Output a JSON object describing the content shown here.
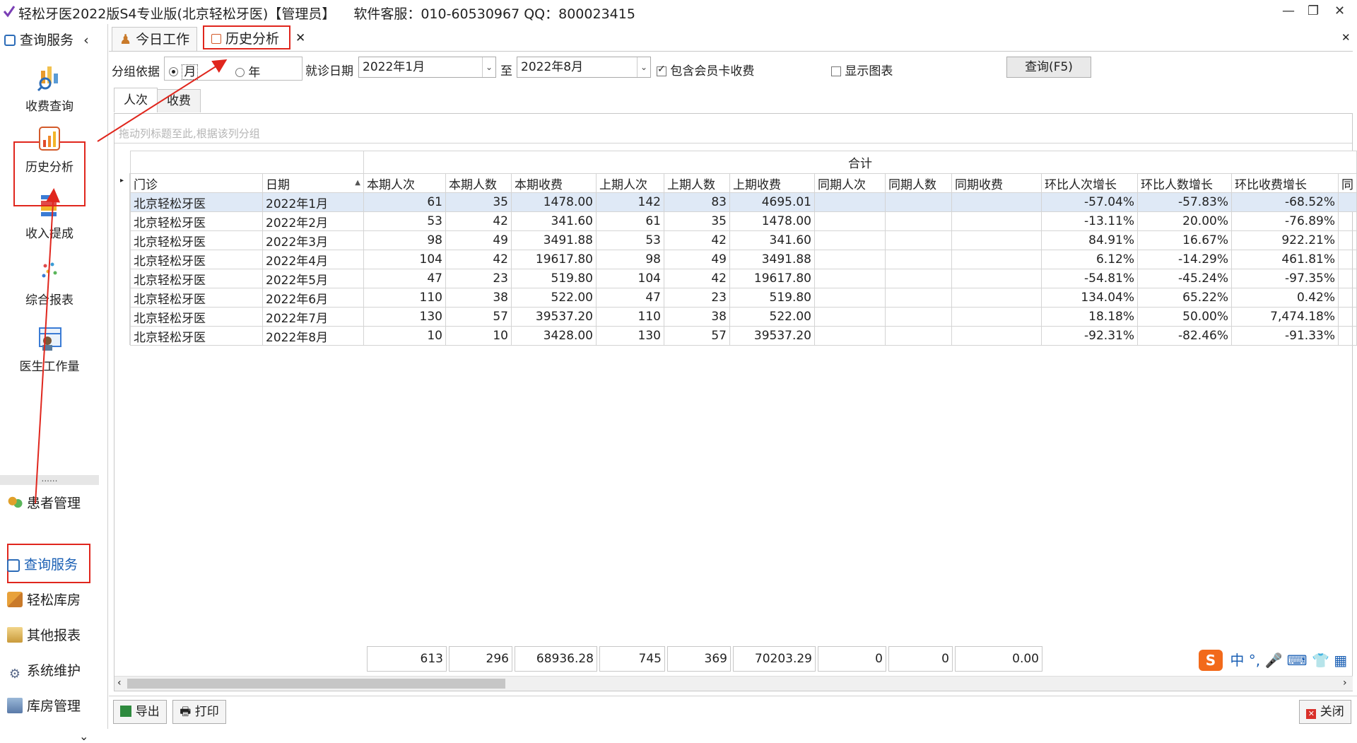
{
  "window": {
    "title": "轻松牙医2022版S4专业版(北京轻松牙医)【管理员】",
    "support": "软件客服：010-60530967 QQ：800023415"
  },
  "sidebar": {
    "header": "查询服务",
    "items": [
      {
        "label": "收费查询",
        "icon": "chart-search-icon"
      },
      {
        "label": "历史分析",
        "icon": "bar-chart-icon"
      },
      {
        "label": "收入提成",
        "icon": "stack-bars-icon"
      },
      {
        "label": "综合报表",
        "icon": "dots-icon"
      },
      {
        "label": "医生工作量",
        "icon": "doctor-calendar-icon"
      }
    ],
    "separator": "......",
    "nav": [
      {
        "label": "患者管理",
        "icon": "patients-icon"
      },
      {
        "label": "查询服务",
        "icon": "query-icon"
      },
      {
        "label": "轻松库房",
        "icon": "warehouse-icon"
      },
      {
        "label": "其他报表",
        "icon": "report-icon"
      },
      {
        "label": "系统维护",
        "icon": "gear-icon"
      },
      {
        "label": "库房管理",
        "icon": "inventory-icon"
      }
    ]
  },
  "tabs": [
    {
      "label": "今日工作",
      "icon": "worker-icon"
    },
    {
      "label": "历史分析",
      "icon": "chart-icon"
    }
  ],
  "filters": {
    "group_label": "分组依据",
    "opt_month": "月",
    "opt_year": "年",
    "date_label": "就诊日期",
    "date_from": "2022年1月",
    "to_label": "至",
    "date_to": "2022年8月",
    "member_label": "包含会员卡收费",
    "chart_label": "显示图表",
    "query_button": "查询(F5)"
  },
  "subtabs": [
    "人次",
    "收费"
  ],
  "grid": {
    "group_hint": "拖动列标题至此,根据该列分组",
    "band_label": "合计",
    "columns": [
      "门诊",
      "日期",
      "本期人次",
      "本期人数",
      "本期收费",
      "上期人次",
      "上期人数",
      "上期收费",
      "同期人次",
      "同期人数",
      "同期收费",
      "环比人次增长",
      "环比人数增长",
      "环比收费增长",
      "同"
    ],
    "rows": [
      [
        "北京轻松牙医",
        "2022年1月",
        "61",
        "35",
        "1478.00",
        "142",
        "83",
        "4695.01",
        "",
        "",
        "",
        "-57.04%",
        "-57.83%",
        "-68.52%"
      ],
      [
        "北京轻松牙医",
        "2022年2月",
        "53",
        "42",
        "341.60",
        "61",
        "35",
        "1478.00",
        "",
        "",
        "",
        "-13.11%",
        "20.00%",
        "-76.89%"
      ],
      [
        "北京轻松牙医",
        "2022年3月",
        "98",
        "49",
        "3491.88",
        "53",
        "42",
        "341.60",
        "",
        "",
        "",
        "84.91%",
        "16.67%",
        "922.21%"
      ],
      [
        "北京轻松牙医",
        "2022年4月",
        "104",
        "42",
        "19617.80",
        "98",
        "49",
        "3491.88",
        "",
        "",
        "",
        "6.12%",
        "-14.29%",
        "461.81%"
      ],
      [
        "北京轻松牙医",
        "2022年5月",
        "47",
        "23",
        "519.80",
        "104",
        "42",
        "19617.80",
        "",
        "",
        "",
        "-54.81%",
        "-45.24%",
        "-97.35%"
      ],
      [
        "北京轻松牙医",
        "2022年6月",
        "110",
        "38",
        "522.00",
        "47",
        "23",
        "519.80",
        "",
        "",
        "",
        "134.04%",
        "65.22%",
        "0.42%"
      ],
      [
        "北京轻松牙医",
        "2022年7月",
        "130",
        "57",
        "39537.20",
        "110",
        "38",
        "522.00",
        "",
        "",
        "",
        "18.18%",
        "50.00%",
        "7,474.18%"
      ],
      [
        "北京轻松牙医",
        "2022年8月",
        "10",
        "10",
        "3428.00",
        "130",
        "57",
        "39537.20",
        "",
        "",
        "",
        "-92.31%",
        "-82.46%",
        "-91.33%"
      ]
    ],
    "totals": [
      "613",
      "296",
      "68936.28",
      "745",
      "369",
      "70203.29",
      "0",
      "0",
      "0.00"
    ]
  },
  "footer": {
    "export": "导出",
    "print": "打印",
    "close": "关闭"
  },
  "ime": {
    "lang": "中"
  },
  "colors": {
    "accent": "#e0261d",
    "selected_row": "#dfe9f6"
  }
}
